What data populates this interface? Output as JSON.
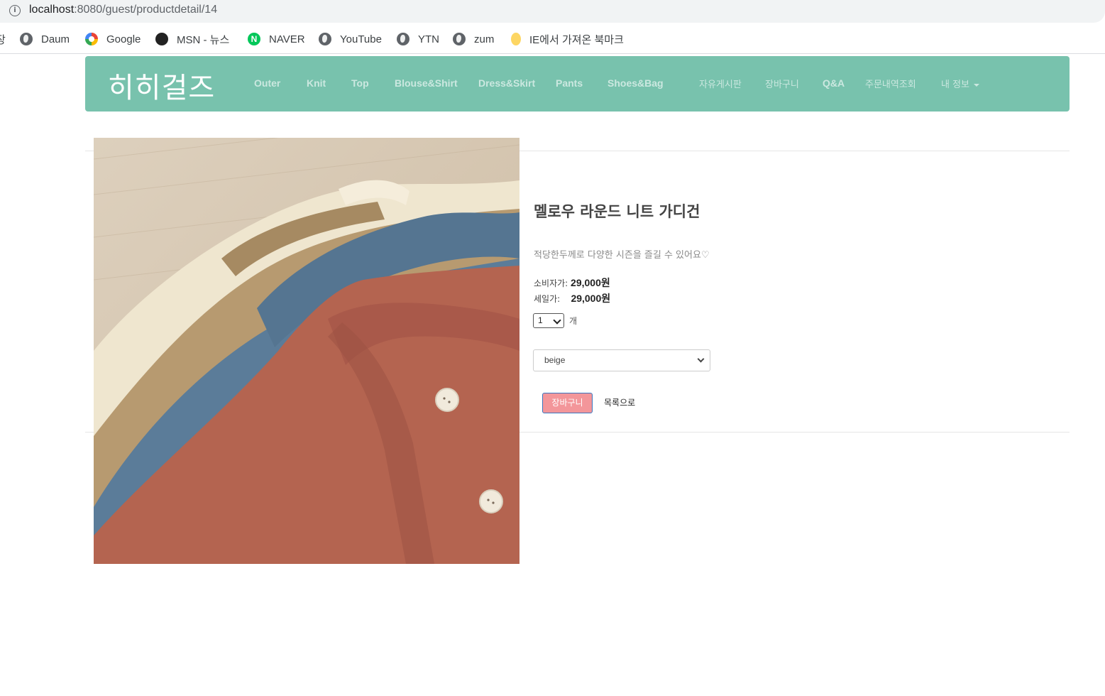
{
  "browser": {
    "url_host": "localhost",
    "url_path": ":8080/guest/productdetail/14",
    "info_icon": "info-icon",
    "bookmarks": [
      {
        "label": "Daum",
        "icon": "globe-icon"
      },
      {
        "label": "Google",
        "icon": "google-icon"
      },
      {
        "label": "MSN - 뉴스",
        "icon": "msn-icon"
      },
      {
        "label": "NAVER",
        "icon": "naver-icon"
      },
      {
        "label": "YouTube",
        "icon": "globe-icon"
      },
      {
        "label": "YTN",
        "icon": "globe-icon"
      },
      {
        "label": "zum",
        "icon": "globe-icon"
      },
      {
        "label": "IE에서 가져온 북마크",
        "icon": "folder-icon"
      }
    ],
    "bookmark_cut": "장"
  },
  "nav": {
    "brand": "히히걸즈",
    "items": [
      "Outer",
      "Knit",
      "Top",
      "Blouse&Shirt",
      "Dress&Skirt",
      "Pants",
      "Shoes&Bag"
    ],
    "right_items": [
      "자유게시판",
      "장바구니",
      "Q&A",
      "주문내역조회"
    ],
    "my_info": "내 정보",
    "colors": {
      "navbar": "#78c2ad",
      "button": "#f3969a"
    }
  },
  "product": {
    "name": "멜로우 라운드 니트 가디건",
    "description": "적당한두께로 다양한 시즌을 즐길 수 있어요♡",
    "retail_label": "소비자가:",
    "retail_price": "29,000원",
    "sale_label": "세일가:",
    "sale_price": "29,000원",
    "quantity": "1",
    "quantity_unit": "개",
    "option": "beige",
    "cart_button": "장바구니",
    "back_link": "목록으로"
  }
}
